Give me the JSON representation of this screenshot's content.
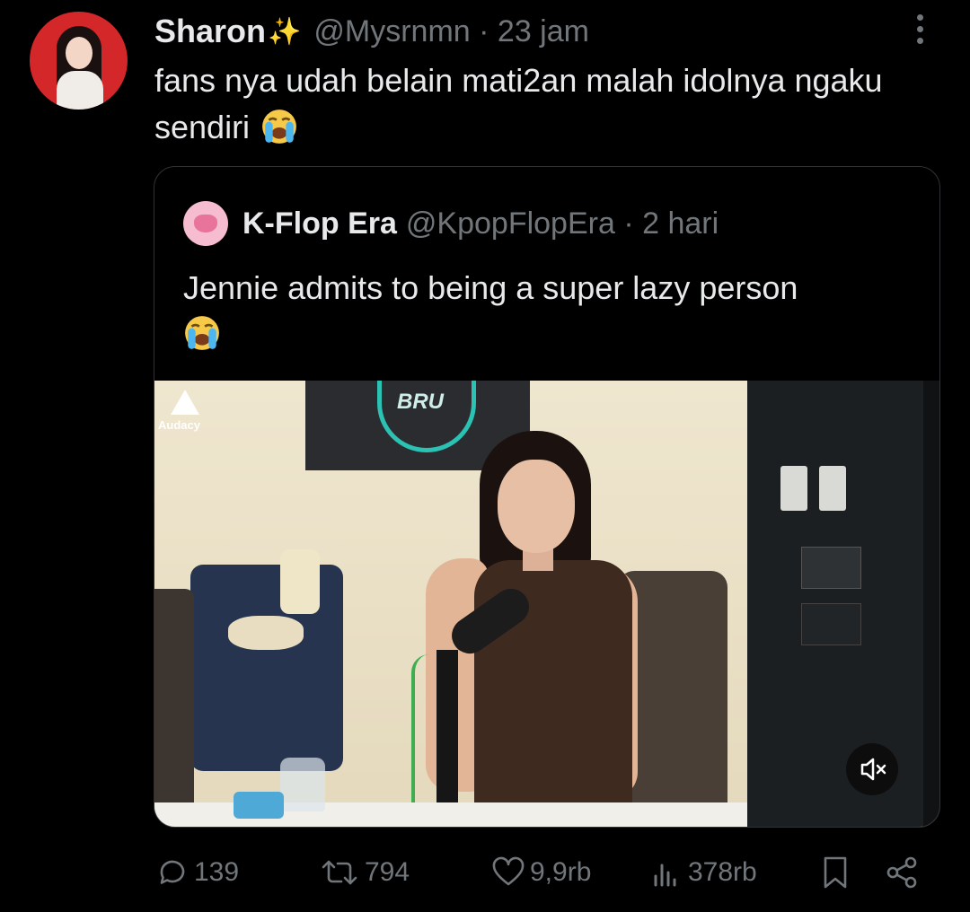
{
  "tweet": {
    "author_name": "Sharon",
    "handle": "@Mysrnmn",
    "time": "23 jam",
    "text": "fans nya udah belain mati2an malah idolnya ngaku sendiri",
    "emoji": "loudly-crying-face"
  },
  "quoted": {
    "author_name": "K-Flop Era",
    "handle": "@KpopFlopEra",
    "time": "2 hari",
    "text": "Jennie admits to being a super lazy person",
    "emoji": "loudly-crying-face",
    "media": {
      "watermark": "Audacy",
      "sign": "BRU"
    }
  },
  "actions": {
    "replies": "139",
    "reposts": "794",
    "likes": "9,9rb",
    "views": "378rb"
  },
  "colors": {
    "background": "#000000",
    "text": "#e7e9ea",
    "muted": "#71767b",
    "border": "#2f3336",
    "avatar_bg": "#d4272a"
  }
}
